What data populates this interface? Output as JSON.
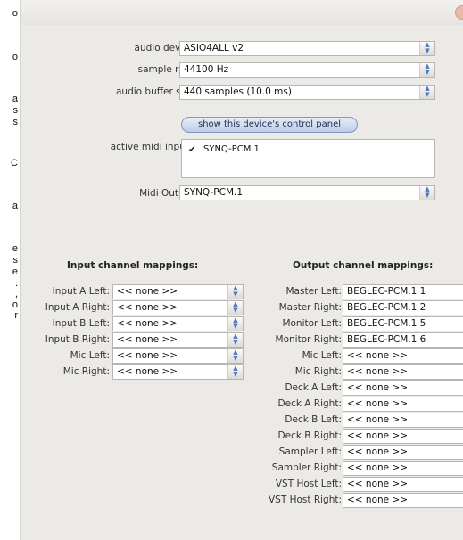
{
  "left_strip": [
    "o",
    "o",
    "a",
    "s",
    "s",
    "C",
    "a",
    "e",
    "s",
    "e",
    ".",
    ",",
    "o",
    "r"
  ],
  "window": {
    "close_color": "#e8b9a6"
  },
  "audio_device": {
    "label": "audio device:",
    "value": "ASIO4ALL v2"
  },
  "sample_rate": {
    "label": "sample rate:",
    "value": "44100 Hz"
  },
  "buffer_size": {
    "label": "audio buffer size:",
    "value": "440 samples (10.0 ms)"
  },
  "control_panel_button": "show this device's control panel",
  "midi_inputs": {
    "label": "active midi inputs:",
    "items": [
      {
        "name": "SYNQ-PCM.1",
        "checked": true
      }
    ]
  },
  "midi_output": {
    "label": "Midi Output:",
    "value": "SYNQ-PCM.1"
  },
  "input_mappings": {
    "heading": "Input channel mappings:",
    "rows": [
      {
        "label": "Input A Left:",
        "value": "<< none >>"
      },
      {
        "label": "Input A Right:",
        "value": "<< none >>"
      },
      {
        "label": "Input B Left:",
        "value": "<< none >>"
      },
      {
        "label": "Input B Right:",
        "value": "<< none >>"
      },
      {
        "label": "Mic Left:",
        "value": "<< none >>"
      },
      {
        "label": "Mic Right:",
        "value": "<< none >>"
      }
    ]
  },
  "output_mappings": {
    "heading": "Output channel mappings:",
    "rows": [
      {
        "label": "Master Left:",
        "value": "BEGLEC-PCM.1 1"
      },
      {
        "label": "Master Right:",
        "value": "BEGLEC-PCM.1 2"
      },
      {
        "label": "Monitor Left:",
        "value": "BEGLEC-PCM.1 5"
      },
      {
        "label": "Monitor Right:",
        "value": "BEGLEC-PCM.1 6"
      },
      {
        "label": "Mic Left:",
        "value": "<< none >>"
      },
      {
        "label": "Mic Right:",
        "value": "<< none >>"
      },
      {
        "label": "Deck A Left:",
        "value": "<< none >>"
      },
      {
        "label": "Deck A Right:",
        "value": "<< none >>"
      },
      {
        "label": "Deck B Left:",
        "value": "<< none >>"
      },
      {
        "label": "Deck B Right:",
        "value": "<< none >>"
      },
      {
        "label": "Sampler Left:",
        "value": "<< none >>"
      },
      {
        "label": "Sampler Right:",
        "value": "<< none >>"
      },
      {
        "label": "VST Host Left:",
        "value": "<< none >>"
      },
      {
        "label": "VST Host Right:",
        "value": "<< none >>"
      }
    ]
  }
}
